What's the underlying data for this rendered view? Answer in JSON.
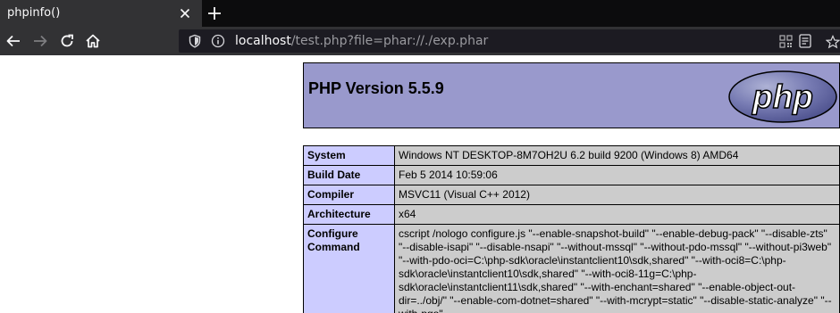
{
  "tab": {
    "title": "phpinfo()"
  },
  "toolbar": {
    "back_icon": "arrow-left-icon",
    "forward_icon": "arrow-right-icon",
    "reload_icon": "reload-icon",
    "home_icon": "home-icon"
  },
  "urlbar": {
    "host": "localhost",
    "path": "/test.php?file=phar://./exp.phar"
  },
  "page": {
    "version_title": "PHP Version 5.5.9",
    "logo_text": "php",
    "rows": [
      {
        "key": "System",
        "value": "Windows NT DESKTOP-8M7OH2U 6.2 build 9200 (Windows 8) AMD64"
      },
      {
        "key": "Build Date",
        "value": "Feb 5 2014 10:59:06"
      },
      {
        "key": "Compiler",
        "value": "MSVC11 (Visual C++ 2012)"
      },
      {
        "key": "Architecture",
        "value": "x64"
      },
      {
        "key": "Configure Command",
        "value": "cscript /nologo configure.js \"--enable-snapshot-build\" \"--enable-debug-pack\" \"--disable-zts\" \"--disable-isapi\" \"--disable-nsapi\" \"--without-mssql\" \"--without-pdo-mssql\" \"--without-pi3web\" \"--with-pdo-oci=C:\\php-sdk\\oracle\\instantclient10\\sdk,shared\" \"--with-oci8=C:\\php-sdk\\oracle\\instantclient10\\sdk,shared\" \"--with-oci8-11g=C:\\php-sdk\\oracle\\instantclient11\\sdk,shared\" \"--with-enchant=shared\" \"--enable-object-out-dir=../obj/\" \"--enable-com-dotnet=shared\" \"--with-mcrypt=static\" \"--disable-static-analyze\" \"--with-pgo\""
      }
    ]
  },
  "colors": {
    "header_bg": "#9999cc",
    "key_bg": "#ccccff",
    "value_bg": "#cccccc",
    "chrome_dark": "#0c0c0d",
    "chrome_toolbar": "#323234"
  }
}
